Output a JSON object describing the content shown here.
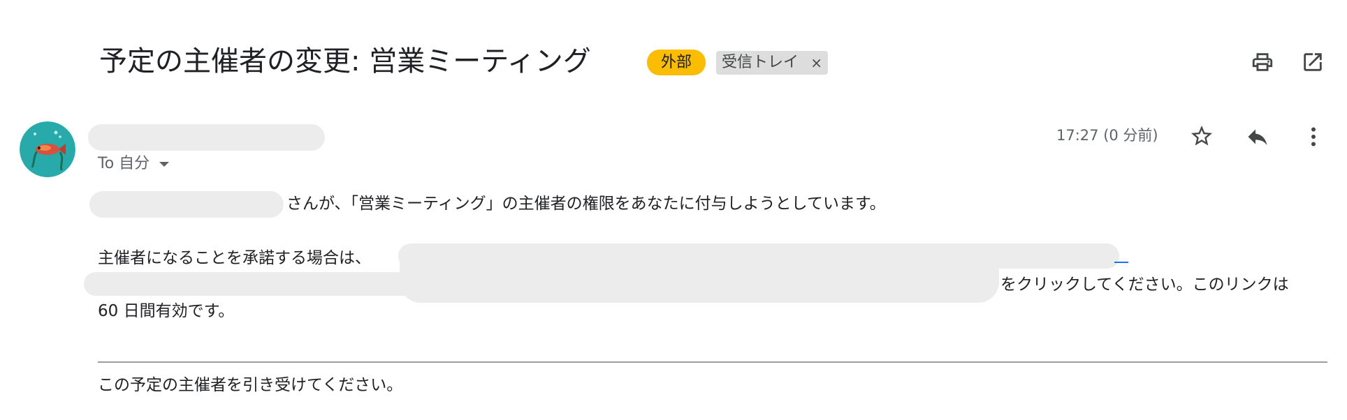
{
  "email": {
    "subject": "予定の主催者の変更: 営業ミーティング",
    "labels": {
      "external": "外部",
      "inbox": "受信トレイ",
      "inbox_remove": "×"
    },
    "recipient_label": "To 自分",
    "timestamp": "17:27 (0 分前)",
    "body": {
      "line1": "さんが、「営業ミーティング」の主催者の権限をあなたに付与しようとしています。",
      "line2": "主催者になることを承諾する場合は、",
      "line3": "をクリックしてください。このリンクは",
      "line4": "60 日間有効です。",
      "footer": "この予定の主催者を引き受けてください。"
    }
  },
  "icons": {
    "print": "print-icon",
    "open_new_window": "open-in-new-window-icon",
    "star": "star-icon",
    "reply": "reply-icon",
    "more": "more-vert-icon",
    "dropdown": "chevron-down-icon"
  },
  "colors": {
    "external_badge": "#fbbc04",
    "inbox_badge": "#dddddd",
    "redaction": "#ececec",
    "link": "#1a73e8",
    "avatar_bg": "#2bb3b1"
  }
}
